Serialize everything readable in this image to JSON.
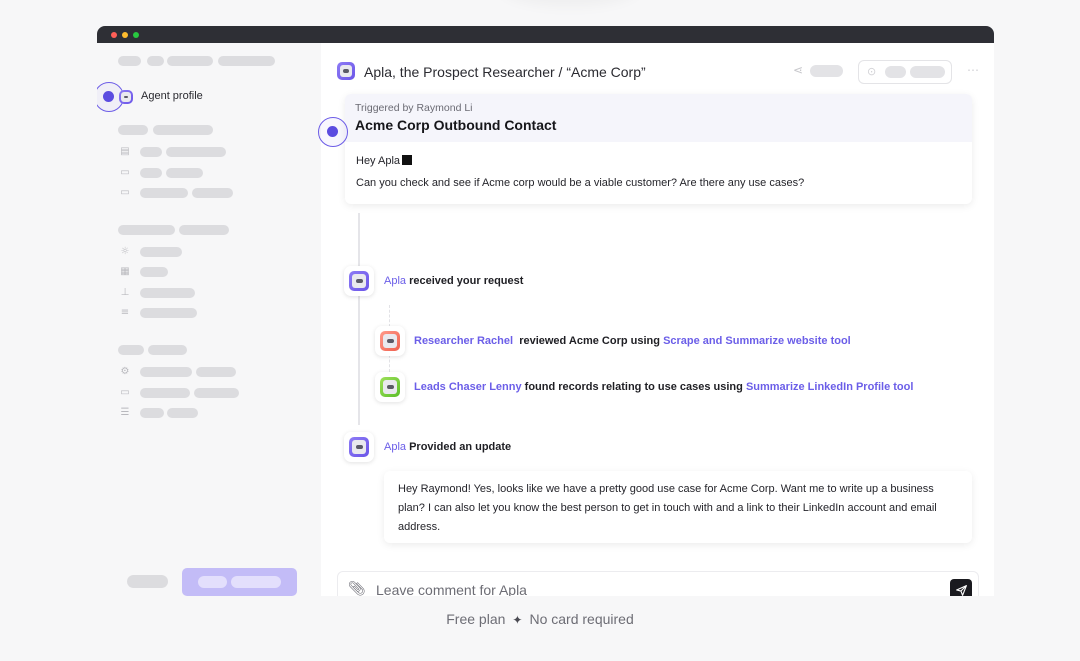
{
  "sidebar": {
    "agent_profile_label": "Agent profile"
  },
  "header": {
    "title": "Apla, the Prospect Researcher / “Acme Corp”"
  },
  "trigger_card": {
    "triggered_by": "Triggered by Raymond Li",
    "title": "Acme Corp Outbound Contact",
    "greeting": "Hey Apla",
    "message": "Can you check and see if Acme corp would be a viable customer? Are there any use cases?"
  },
  "events": [
    {
      "actor": "Apla",
      "text": "received your request"
    },
    {
      "actor": "Researcher Rachel",
      "text": "reviewed Acme Corp using",
      "tool": "Scrape and Summarize website tool"
    },
    {
      "actor": "Leads Chaser Lenny",
      "text": "found records relating to use cases using",
      "tool": "Summarize LinkedIn Profile tool"
    },
    {
      "actor": "Apla",
      "text": "Provided an update"
    }
  ],
  "reply": {
    "text": "Hey Raymond! Yes, looks like we have a pretty good use case for Acme Corp. Want me to write up a business plan? I can also let you know the best person to get in touch with and a link to their LinkedIn account and email address."
  },
  "comment": {
    "placeholder": "Leave comment for Apla"
  },
  "footer": {
    "left": "Free plan",
    "separator": "✦",
    "right": "No card required"
  },
  "icons": {
    "attach": "paperclip-icon",
    "send": "send-icon",
    "share": "share-icon",
    "more": "more-icon"
  },
  "colors": {
    "accent": "#6b5ee8",
    "titlebar": "#2e2f35"
  }
}
